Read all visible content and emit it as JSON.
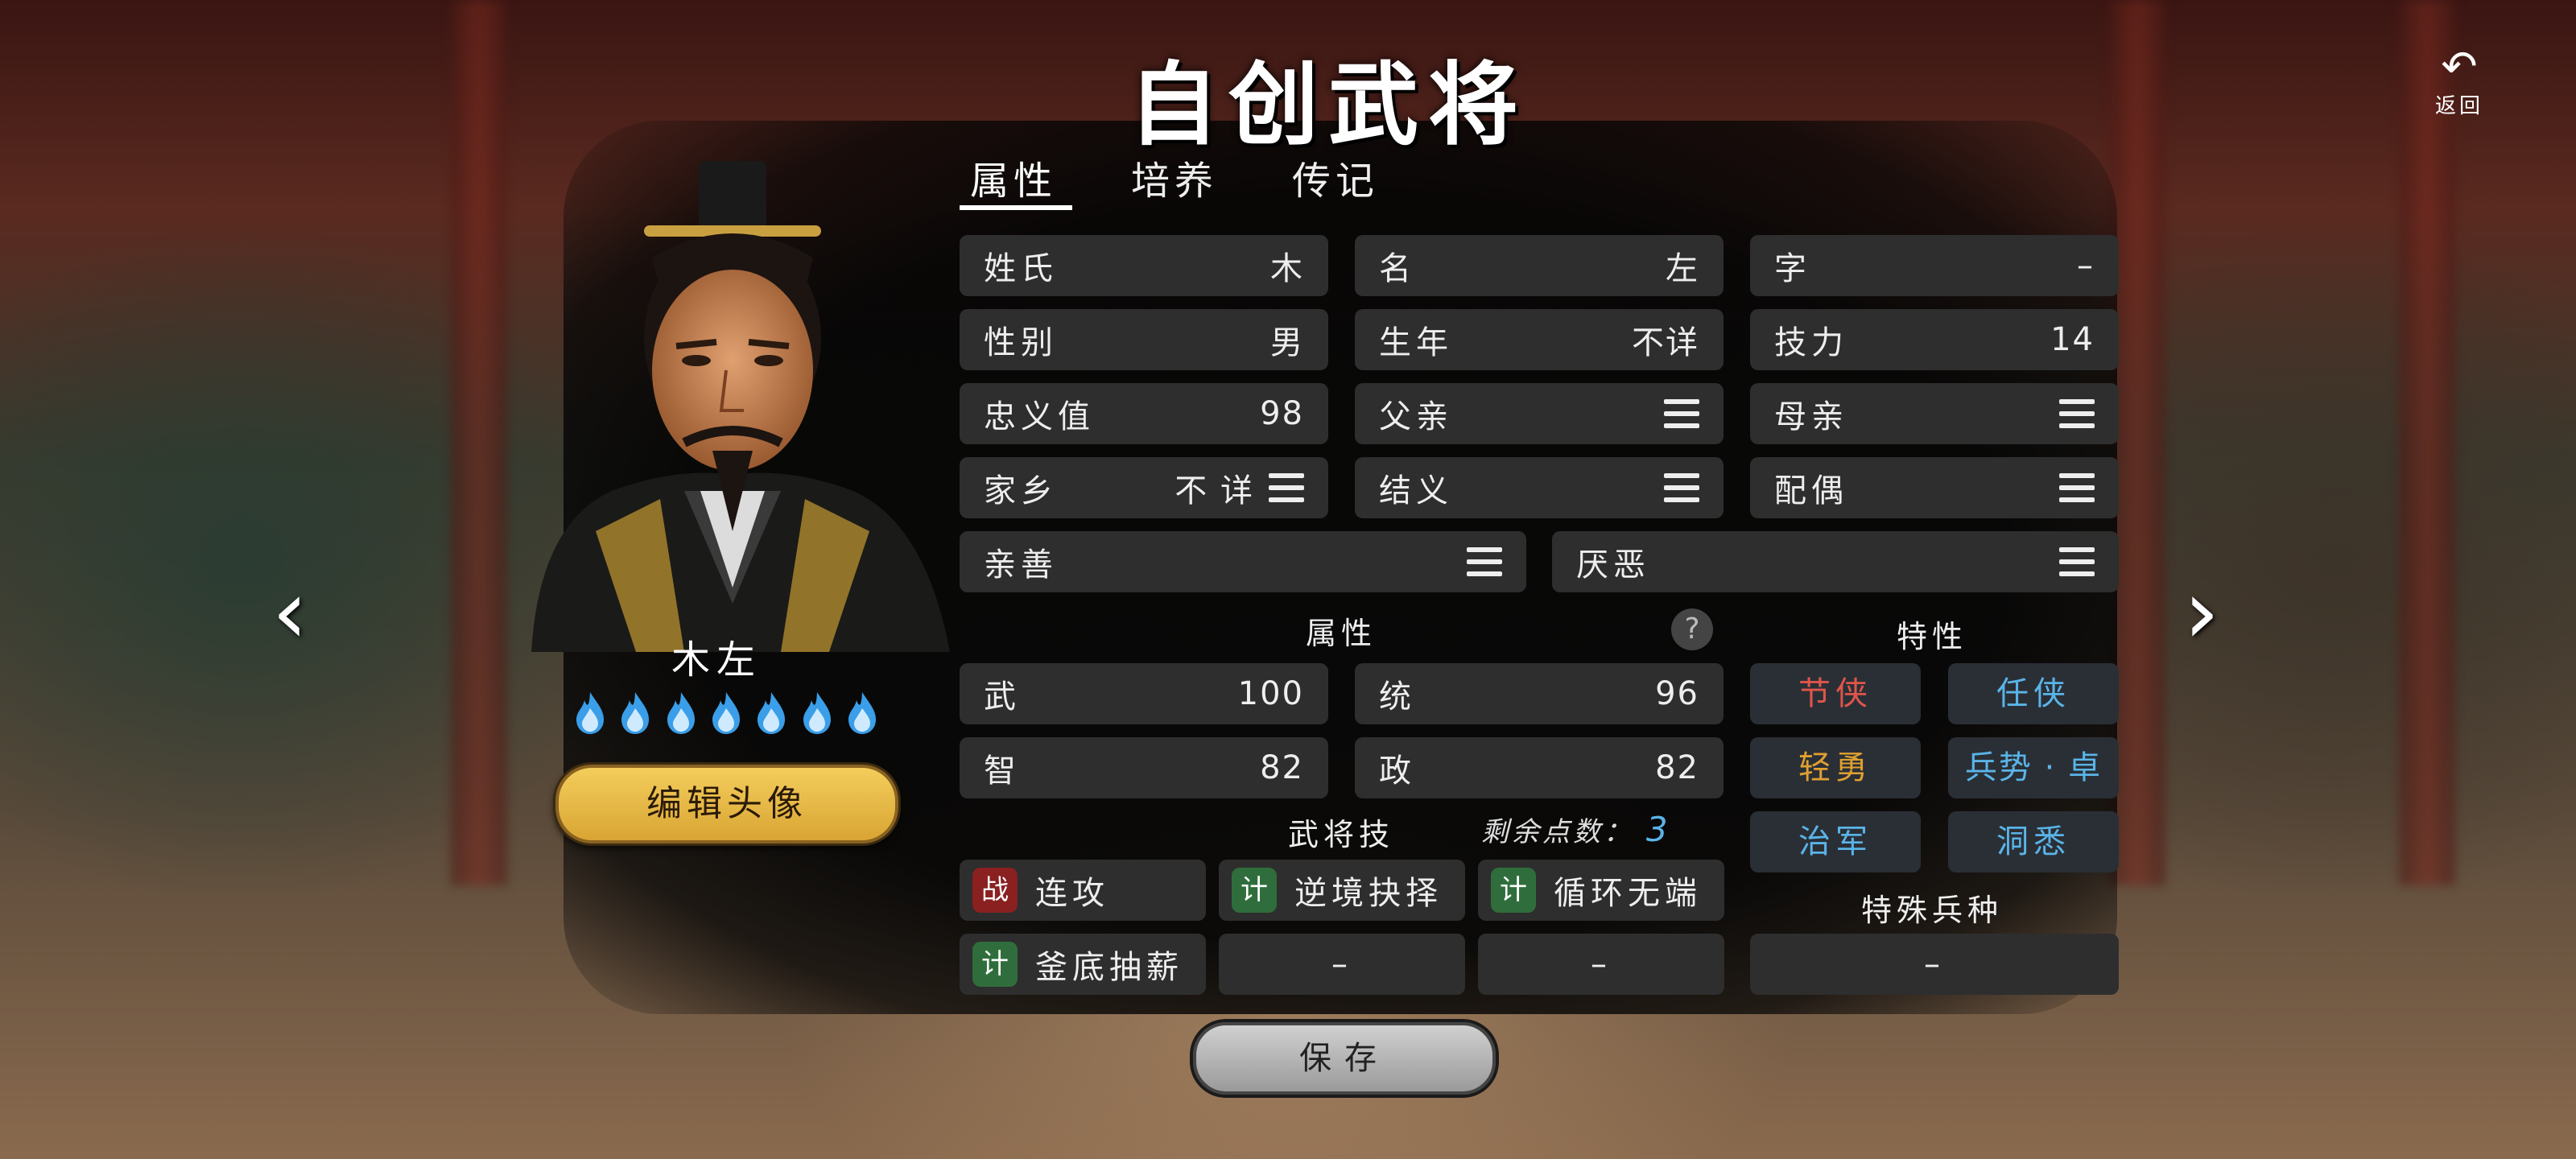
{
  "title": "自创武将",
  "back": {
    "label": "返回"
  },
  "tabs": [
    {
      "label": "属性"
    },
    {
      "label": "培养"
    },
    {
      "label": "传记"
    }
  ],
  "hero": {
    "name": "木左",
    "flames": 7,
    "edit_avatar_label": "编辑头像"
  },
  "fields": {
    "surname": {
      "label": "姓氏",
      "value": "木"
    },
    "given_name": {
      "label": "名",
      "value": "左"
    },
    "courtesy": {
      "label": "字",
      "value": "–"
    },
    "gender": {
      "label": "性别",
      "value": "男"
    },
    "birth_year": {
      "label": "生年",
      "value": "不详"
    },
    "skill_power": {
      "label": "技力",
      "value": "14"
    },
    "loyalty": {
      "label": "忠义值",
      "value": "98"
    },
    "father": {
      "label": "父亲"
    },
    "mother": {
      "label": "母亲"
    },
    "hometown": {
      "label": "家乡",
      "value": "不 详"
    },
    "sworn": {
      "label": "结义"
    },
    "spouse": {
      "label": "配偶"
    },
    "likes": {
      "label": "亲善"
    },
    "dislikes": {
      "label": "厌恶"
    }
  },
  "attributes": {
    "title": "属性",
    "war": {
      "label": "武",
      "value": "100"
    },
    "lead": {
      "label": "统",
      "value": "96"
    },
    "intel": {
      "label": "智",
      "value": "82"
    },
    "politics": {
      "label": "政",
      "value": "82"
    }
  },
  "traits": {
    "title": "特性",
    "items": [
      {
        "label": "节侠",
        "color": "#e0554a"
      },
      {
        "label": "任侠",
        "color": "#5ab4e8"
      },
      {
        "label": "轻勇",
        "color": "#e0a030"
      },
      {
        "label": "兵势 · 卓",
        "color": "#5ab4e8"
      },
      {
        "label": "治军",
        "color": "#5ab4e8"
      },
      {
        "label": "洞悉",
        "color": "#5ab4e8"
      }
    ]
  },
  "skills": {
    "title": "武将技",
    "points_label": "剩余点数：",
    "points_value": "3",
    "items": [
      {
        "badge": "战",
        "badge_color": "red",
        "label": "连攻"
      },
      {
        "badge": "计",
        "badge_color": "green",
        "label": "逆境抉择"
      },
      {
        "badge": "计",
        "badge_color": "green",
        "label": "循环无端"
      },
      {
        "badge": "计",
        "badge_color": "green",
        "label": "釜底抽薪"
      }
    ],
    "empty_label": "–"
  },
  "special_troop": {
    "title": "特殊兵种",
    "value": "–"
  },
  "save_label": "保存"
}
